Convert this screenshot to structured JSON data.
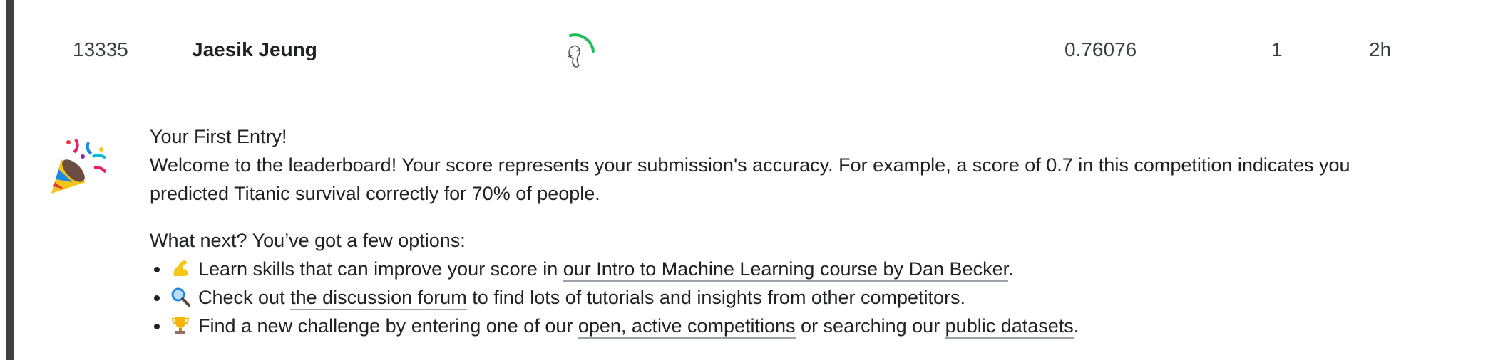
{
  "leaderboard_row": {
    "rank": "13335",
    "team_name": "Jaesik Jeung",
    "score": "0.76076",
    "entries": "1",
    "last": "2h"
  },
  "message": {
    "title": "Your First Entry!",
    "body": "Welcome to the leaderboard! Your score represents your submission's accuracy. For example, a score of 0.7 in this competition indicates you predicted Titanic survival correctly for 70% of people.",
    "body_line1": "Welcome to the leaderboard! Your score represents your submission's accuracy. For example, a score of 0.7 in this competition indicates you",
    "body_line2": "predicted Titanic survival correctly for 70% of people.",
    "what_next": "What next? You’ve got a few options:",
    "options": [
      {
        "icon": "flexed-biceps-icon",
        "pre": "Learn skills that can improve your score in ",
        "link": "our Intro to Machine Learning course by Dan Becker",
        "post": "."
      },
      {
        "icon": "magnifying-glass-icon",
        "pre": "Check out ",
        "link": "the discussion forum",
        "post": " to find lots of tutorials and insights from other competitors."
      },
      {
        "icon": "trophy-icon",
        "pre": "Find a new challenge by entering one of our ",
        "link": "open, active competitions",
        "mid": " or searching our ",
        "link2": "public datasets",
        "post": "."
      }
    ]
  },
  "colors": {
    "accent_bar": "#3c4043",
    "avatar_ring": "#20be5a",
    "link_underline": "#9aa0a6"
  }
}
